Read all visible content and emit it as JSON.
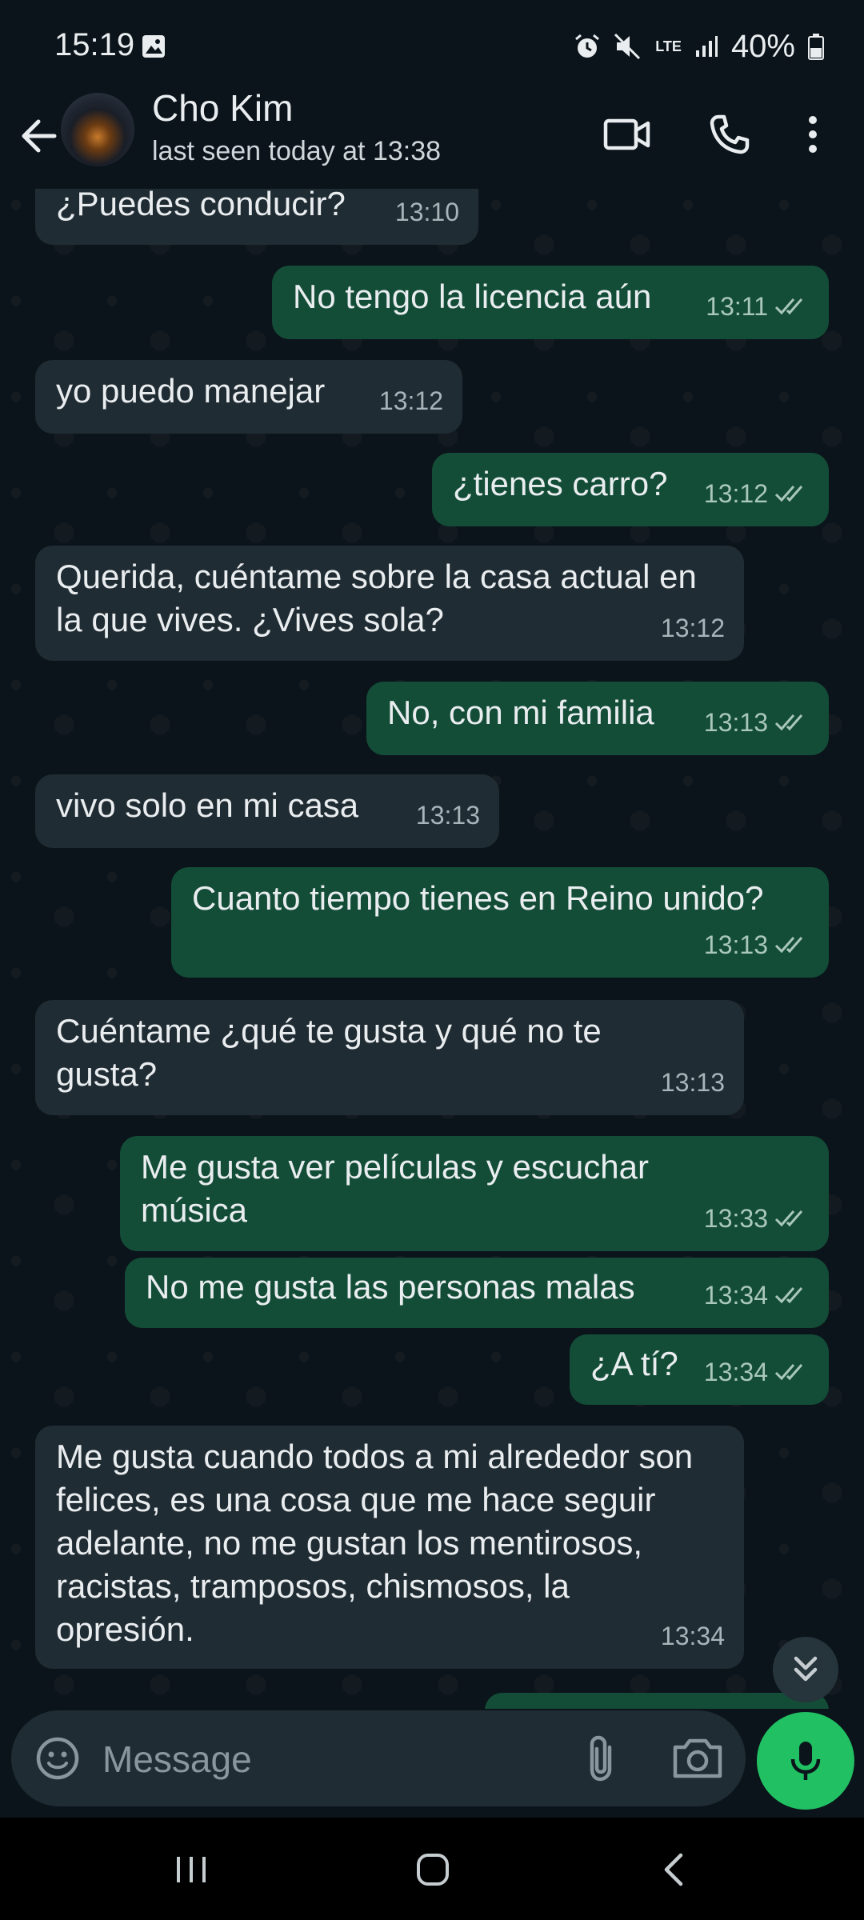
{
  "status_bar": {
    "time": "15:19",
    "network": "LTE",
    "battery": "40%"
  },
  "header": {
    "contact_name": "Cho Kim",
    "last_seen": "last seen today at 13:38"
  },
  "messages": [
    {
      "dir": "in",
      "text": "¿Puedes conducir?",
      "time": "13:10"
    },
    {
      "dir": "out",
      "text": "No tengo la licencia aún",
      "time": "13:11"
    },
    {
      "dir": "in",
      "text": "yo puedo manejar",
      "time": "13:12"
    },
    {
      "dir": "out",
      "text": "¿tienes carro?",
      "time": "13:12"
    },
    {
      "dir": "in",
      "text": "Querida, cuéntame sobre la casa actual en la que vives. ¿Vives sola?",
      "time": "13:12"
    },
    {
      "dir": "out",
      "text": "No, con mi familia",
      "time": "13:13"
    },
    {
      "dir": "in",
      "text": "vivo solo en mi casa",
      "time": "13:13"
    },
    {
      "dir": "out",
      "text": "Cuanto tiempo tienes en Reino unido?",
      "time": "13:13"
    },
    {
      "dir": "in",
      "text": "Cuéntame ¿qué te gusta y qué no te gusta?",
      "time": "13:13"
    },
    {
      "dir": "out",
      "text": "Me gusta ver películas y escuchar música",
      "time": "13:33"
    },
    {
      "dir": "out",
      "text": "No me gusta las personas malas",
      "time": "13:34"
    },
    {
      "dir": "out",
      "text": "¿A tí?",
      "time": "13:34"
    },
    {
      "dir": "in",
      "text": "Me gusta cuando todos a mi alrededor son felices, es una cosa que me hace seguir adelante, no me gustan los mentirosos, racistas, tramposos, chismosos, la opresión.",
      "time": "13:34"
    }
  ],
  "composer": {
    "placeholder": "Message"
  },
  "colors": {
    "background": "#0b141a",
    "incoming_bubble": "#202c33",
    "outgoing_bubble": "#134d37",
    "accent": "#21c063"
  },
  "icons": {
    "back": "arrow-left-icon",
    "video": "video-call-icon",
    "call": "phone-icon",
    "menu": "more-vert-icon",
    "emoji": "emoji-icon",
    "attach": "paperclip-icon",
    "camera": "camera-icon",
    "mic": "mic-icon",
    "scroll": "double-chevron-down-icon"
  }
}
